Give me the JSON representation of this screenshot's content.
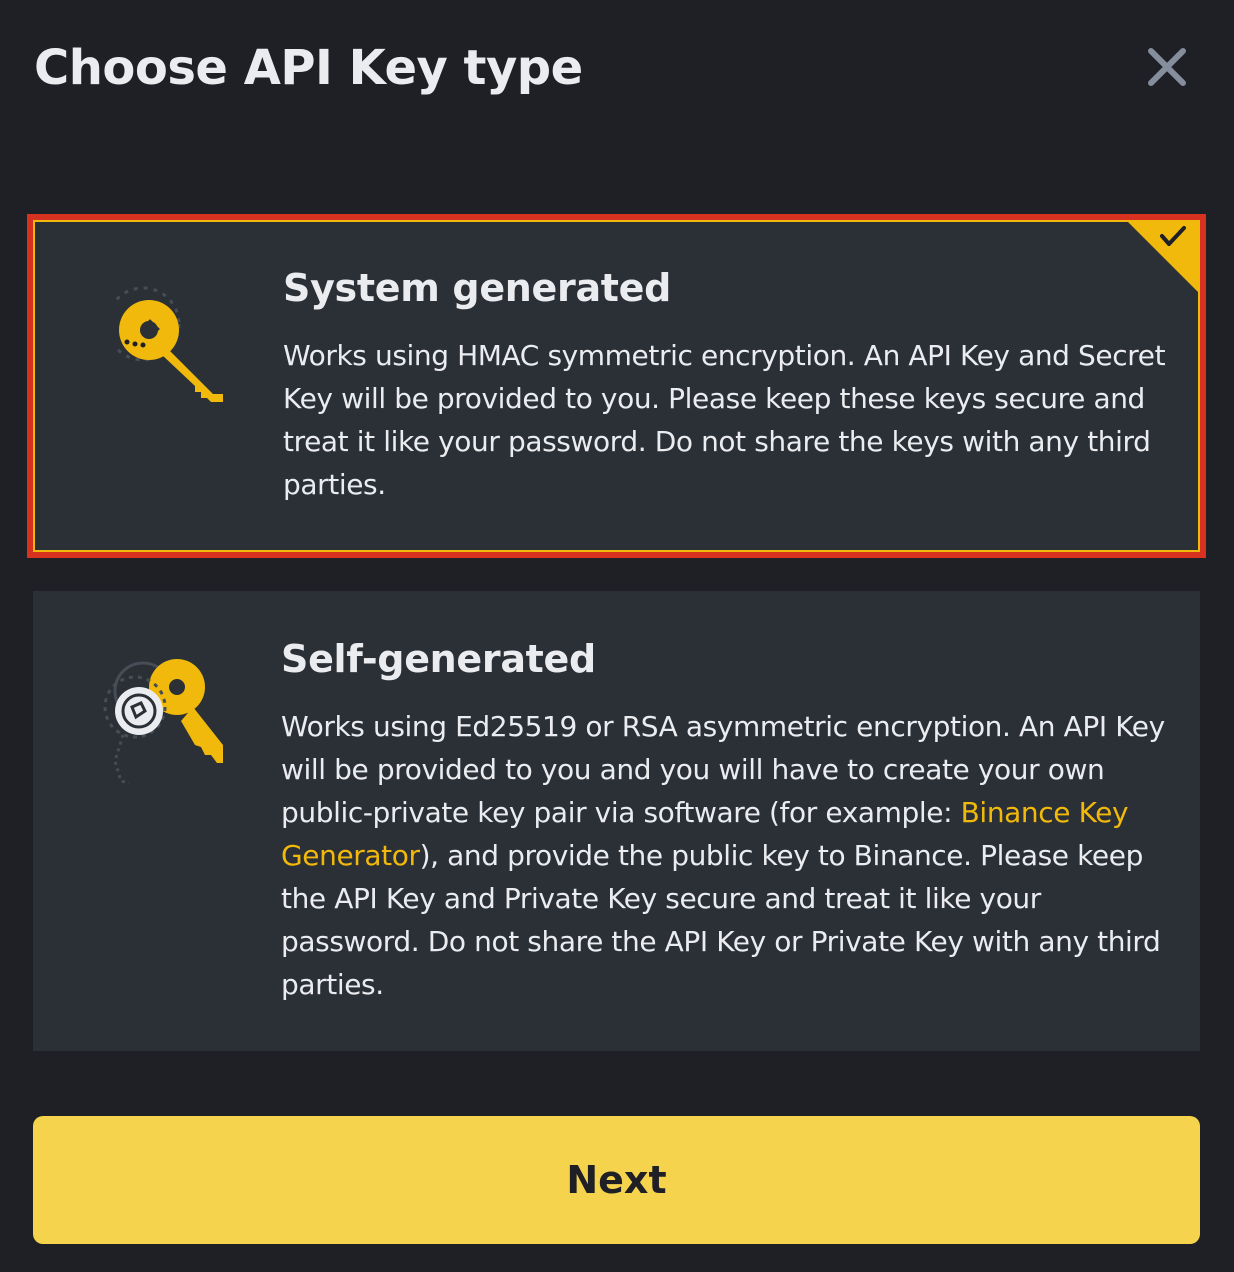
{
  "dialog": {
    "title": "Choose API Key type",
    "close_icon": "close-icon"
  },
  "options": {
    "system": {
      "title": "System generated",
      "description": "Works using HMAC symmetric encryption. An API Key and Secret Key will be provided to you. Please keep these keys secure and treat it like your password. Do not share the keys with any third parties.",
      "selected": true,
      "icon": "golden-key-icon",
      "check_icon": "checkmark-icon"
    },
    "self": {
      "title": "Self-generated",
      "description_before_link": "Works using Ed25519 or RSA asymmetric encryption. An API Key will be provided to you and you will have to create your own public-private key pair via software (for example: ",
      "link_text": "Binance Key Generator",
      "description_after_link": "), and provide the public key to Binance. Please keep the API Key and Private Key secure and treat it like your password. Do not share the API Key or Private Key with any third parties.",
      "selected": false,
      "icon": "key-pair-icon"
    }
  },
  "footer": {
    "next_label": "Next"
  },
  "colors": {
    "background": "#1e2026",
    "card": "#2b2f36",
    "accent": "#f0b90b",
    "button": "#f5d34d",
    "highlight_outline": "#d7321f",
    "text": "#eaecef"
  }
}
